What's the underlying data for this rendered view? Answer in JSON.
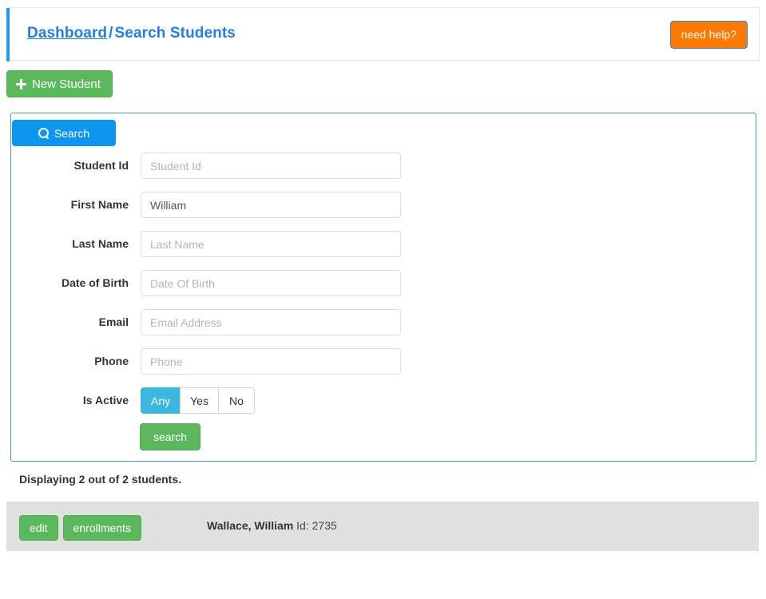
{
  "header": {
    "breadcrumb": {
      "link_label": "Dashboard",
      "separator": "/",
      "current_label": "Search Students"
    },
    "help_button_label": "need help?",
    "accent_color": "#1e9cf5"
  },
  "toolbar": {
    "new_student_label": "New Student",
    "new_student_icon": "plus-icon",
    "new_student_color": "#5cb85c"
  },
  "search_panel": {
    "tab_label": "Search",
    "tab_icon": "magnifier-icon",
    "tab_color": "#0d96ef",
    "border_color": "#3a9fdb",
    "fields": [
      {
        "label": "Student Id",
        "placeholder": "Student Id",
        "value": ""
      },
      {
        "label": "First Name",
        "placeholder": "First Name",
        "value": "William"
      },
      {
        "label": "Last Name",
        "placeholder": "Last Name",
        "value": ""
      },
      {
        "label": "Date of Birth",
        "placeholder": "Date Of Birth",
        "value": ""
      },
      {
        "label": "Email",
        "placeholder": "Email Address",
        "value": ""
      },
      {
        "label": "Phone",
        "placeholder": "Phone",
        "value": ""
      }
    ],
    "is_active": {
      "label": "Is Active",
      "options": [
        "Any",
        "Yes",
        "No"
      ],
      "selected": "Any",
      "selected_color": "#3bb8dd"
    },
    "submit_label": "search",
    "submit_color": "#5cb85c"
  },
  "results": {
    "count_text": "Displaying 2 out of 2 students.",
    "row_background": "#e0e0e0",
    "rows": [
      {
        "edit_label": "edit",
        "enrollments_label": "enrollments",
        "name": "Wallace, William",
        "id_text": "Id: 2735"
      }
    ]
  }
}
